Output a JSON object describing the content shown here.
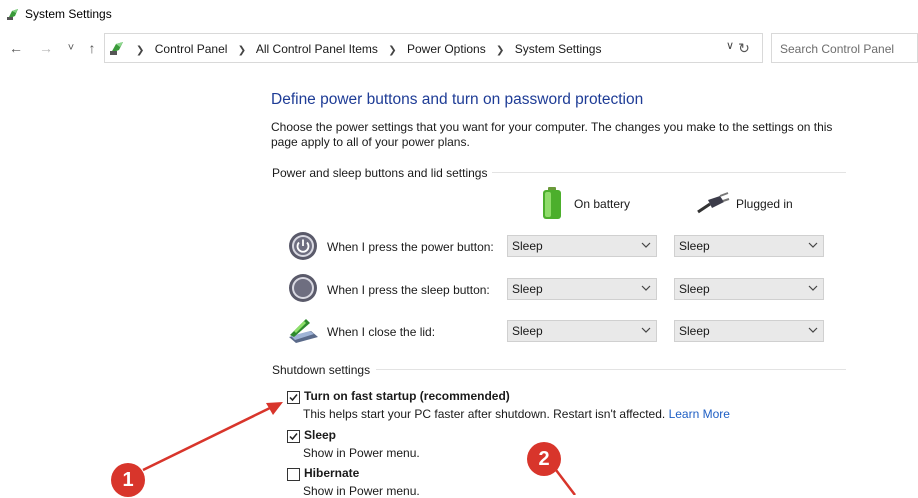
{
  "window": {
    "title": "System Settings",
    "app_icon": "power-options-icon"
  },
  "nav": {
    "back": "←",
    "forward": "→",
    "recent": "˅",
    "up": "↑",
    "breadcrumbs": [
      "Control Panel",
      "All Control Panel Items",
      "Power Options",
      "System Settings"
    ],
    "dropdown": "∨",
    "refresh": "↻",
    "search_placeholder": "Search Control Panel"
  },
  "main": {
    "heading": "Define power buttons and turn on password protection",
    "description": "Choose the power settings that you want for your computer. The changes you make to the settings on this page apply to all of your power plans.",
    "buttons_section": "Power and sleep buttons and lid settings",
    "columns": {
      "battery": "On battery",
      "plugged": "Plugged in"
    },
    "rows": [
      {
        "label": "When I press the power button:",
        "icon": "power-button-icon",
        "battery": "Sleep",
        "plugged": "Sleep"
      },
      {
        "label": "When I press the sleep button:",
        "icon": "sleep-button-icon",
        "battery": "Sleep",
        "plugged": "Sleep"
      },
      {
        "label": "When I close the lid:",
        "icon": "laptop-lid-icon",
        "battery": "Sleep",
        "plugged": "Sleep"
      }
    ],
    "shutdown_section": "Shutdown settings",
    "shutdown": [
      {
        "label": "Turn on fast startup (recommended)",
        "desc": "This helps start your PC faster after shutdown. Restart isn't affected.",
        "link": "Learn More",
        "checked": true
      },
      {
        "label": "Sleep",
        "desc": "Show in Power menu.",
        "checked": true
      },
      {
        "label": "Hibernate",
        "desc": "Show in Power menu.",
        "checked": false
      }
    ]
  },
  "annotations": {
    "badge1": "1",
    "badge2": "2",
    "color": "#d8352b"
  }
}
